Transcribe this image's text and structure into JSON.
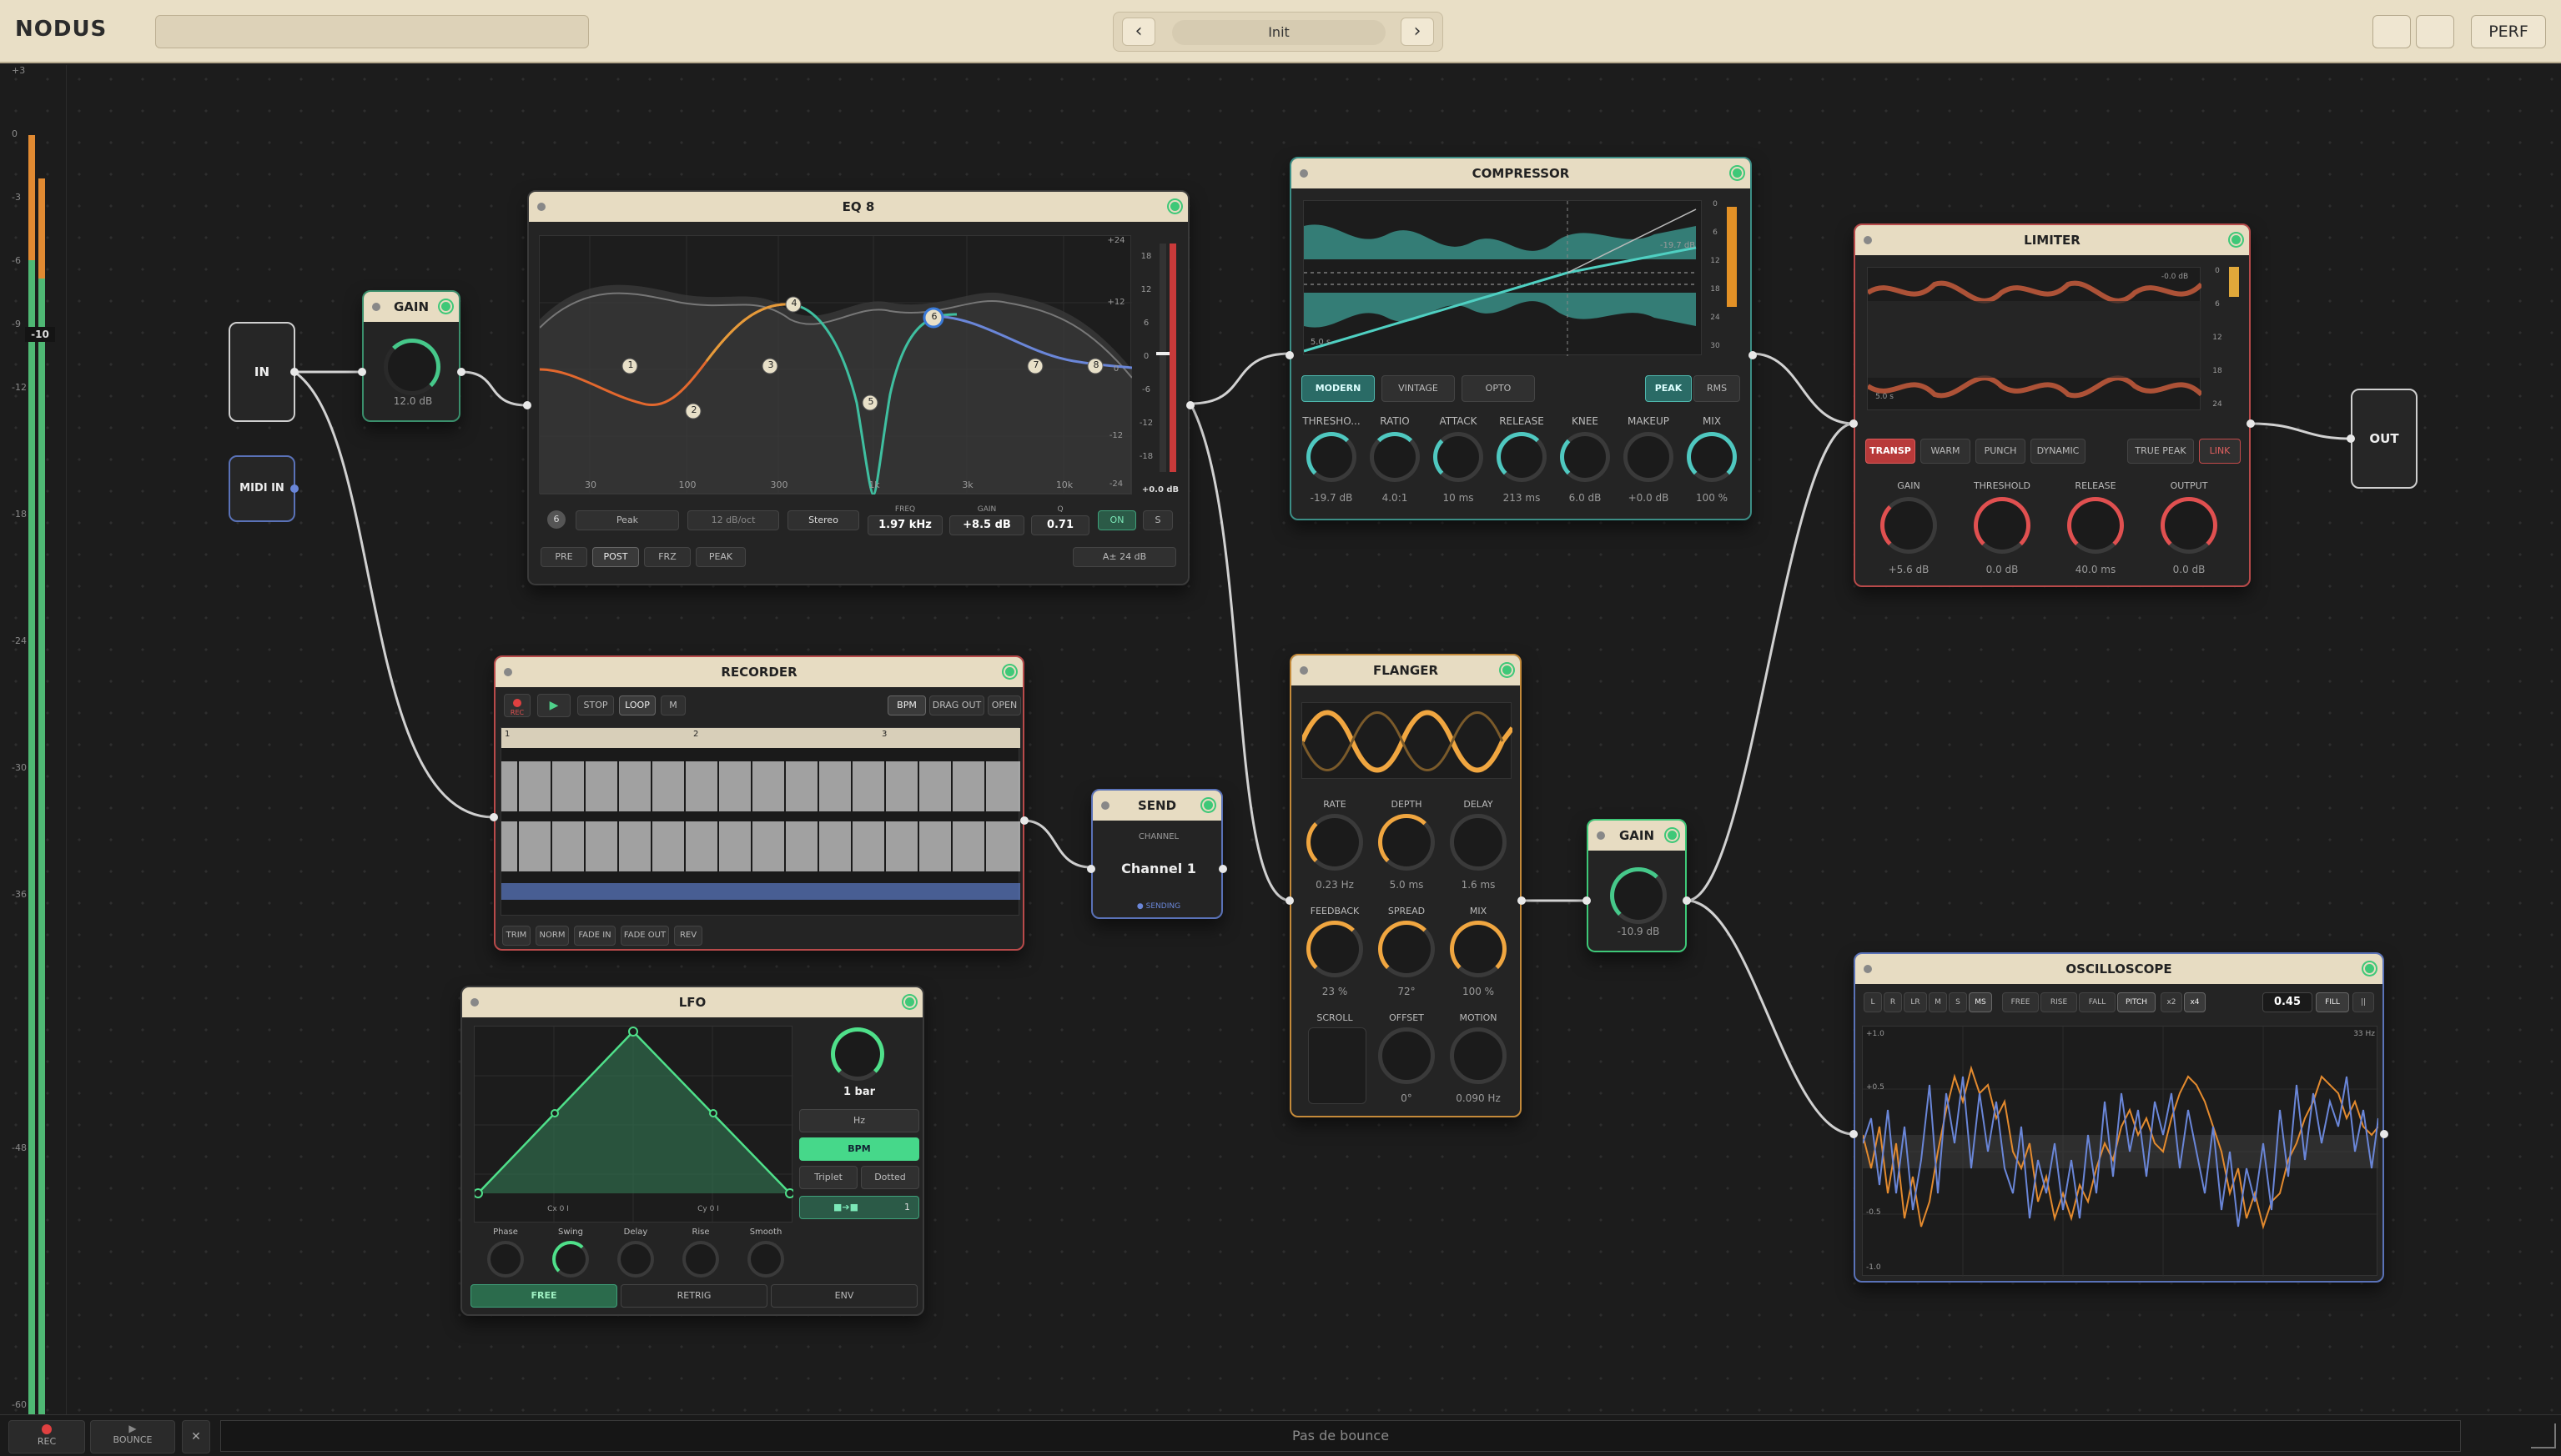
{
  "app": {
    "title": "NODUS",
    "preset": "Init",
    "perf_label": "PERF"
  },
  "meter": {
    "ticks": [
      "+3",
      "0",
      "-3",
      "-6",
      "-9",
      "-12",
      "-18",
      "-24",
      "-30",
      "-36",
      "-48",
      "-60"
    ],
    "readout": "-10"
  },
  "io": {
    "in": "IN",
    "midi_in": "MIDI IN",
    "out": "OUT"
  },
  "gain1": {
    "title": "GAIN",
    "value": "12.0 dB"
  },
  "eq": {
    "title": "EQ 8",
    "freq_labels": [
      "30",
      "100",
      "300",
      "1k",
      "3k",
      "10k"
    ],
    "db_labels": [
      "+24",
      "+12",
      "0",
      "-12",
      "-24"
    ],
    "db_right": [
      "18",
      "12",
      "6",
      "0",
      "-6",
      "-12",
      "-18"
    ],
    "meter_readout": "+0.0 dB",
    "band_num": "6",
    "type": "Peak",
    "slope": "12 dB/oct",
    "mode": "Stereo",
    "freq_label": "FREQ",
    "freq": "1.97 kHz",
    "gain_label": "GAIN",
    "gain": "+8.5 dB",
    "q_label": "Q",
    "q": "0.71",
    "on": "ON",
    "solo": "S",
    "pre": "PRE",
    "post": "POST",
    "frz": "FRZ",
    "peak": "PEAK",
    "range": "A± 24 dB",
    "points": [
      "1",
      "2",
      "3",
      "4",
      "5",
      "6",
      "7",
      "8"
    ]
  },
  "compressor": {
    "title": "COMPRESSOR",
    "modes": [
      "MODERN",
      "VINTAGE",
      "OPTO"
    ],
    "det": [
      "PEAK",
      "RMS"
    ],
    "thresh_tag": "-19.7 dB",
    "ratio_tag": "5.0 s",
    "scale": [
      "0",
      "6",
      "12",
      "18",
      "24",
      "30"
    ],
    "knobs": [
      {
        "label": "THRESHO...",
        "value": "-19.7 dB"
      },
      {
        "label": "RATIO",
        "value": "4.0:1"
      },
      {
        "label": "ATTACK",
        "value": "10 ms"
      },
      {
        "label": "RELEASE",
        "value": "213 ms"
      },
      {
        "label": "KNEE",
        "value": "6.0 dB"
      },
      {
        "label": "MAKEUP",
        "value": "+0.0 dB"
      },
      {
        "label": "MIX",
        "value": "100 %"
      }
    ]
  },
  "limiter": {
    "title": "LIMITER",
    "modes": [
      "TRANSP",
      "WARM",
      "PUNCH",
      "DYNAMIC"
    ],
    "true_peak": "TRUE PEAK",
    "link": "LINK",
    "scope_tag": "-0.0 dB",
    "scope_time": "5.0 s",
    "scale": [
      "0",
      "6",
      "12",
      "18",
      "24"
    ],
    "knobs": [
      {
        "label": "GAIN",
        "value": "+5.6 dB"
      },
      {
        "label": "THRESHOLD",
        "value": "0.0 dB"
      },
      {
        "label": "RELEASE",
        "value": "40.0 ms"
      },
      {
        "label": "OUTPUT",
        "value": "0.0 dB"
      }
    ]
  },
  "recorder": {
    "title": "RECORDER",
    "rec": "REC",
    "stop": "STOP",
    "loop": "LOOP",
    "m": "M",
    "bpm": "BPM",
    "drag_out": "DRAG OUT",
    "open": "OPEN",
    "bars": [
      "1",
      "2",
      "3"
    ],
    "tools": [
      "TRIM",
      "NORM",
      "FADE IN",
      "FADE OUT",
      "REV"
    ]
  },
  "send": {
    "title": "SEND",
    "channel_label": "CHANNEL",
    "channel": "Channel 1",
    "status": "● SENDING"
  },
  "flanger": {
    "title": "FLANGER",
    "knobs": [
      {
        "label": "RATE",
        "value": "0.23 Hz"
      },
      {
        "label": "DEPTH",
        "value": "5.0 ms"
      },
      {
        "label": "DELAY",
        "value": "1.6 ms"
      },
      {
        "label": "FEEDBACK",
        "value": "23 %"
      },
      {
        "label": "SPREAD",
        "value": "72°"
      },
      {
        "label": "MIX",
        "value": "100 %"
      },
      {
        "label": "SCROLL",
        "value": ""
      },
      {
        "label": "OFFSET",
        "value": "0°"
      },
      {
        "label": "MOTION",
        "value": "0.090 Hz"
      }
    ]
  },
  "gain2": {
    "title": "GAIN",
    "value": "-10.9 dB"
  },
  "lfo": {
    "title": "LFO",
    "rate": "1 bar",
    "hz": "Hz",
    "bpm": "BPM",
    "triplet": "Triplet",
    "dotted": "Dotted",
    "sync_value": "1",
    "phase_left": "Cx 0 I",
    "phase_right": "Cy 0 I",
    "knobs": [
      "Phase",
      "Swing",
      "Delay",
      "Rise",
      "Smooth"
    ],
    "modes": [
      "FREE",
      "RETRIG",
      "ENV"
    ]
  },
  "scope": {
    "title": "OSCILLOSCOPE",
    "chan": [
      "L",
      "R",
      "LR",
      "M",
      "S",
      "MS"
    ],
    "trig": [
      "FREE",
      "RISE",
      "FALL",
      "PITCH"
    ],
    "zoom": [
      "x2",
      "x4"
    ],
    "value": "0.45",
    "fill": "FILL",
    "menu": "||",
    "freq": "33 Hz",
    "y": [
      "+1.0",
      "+0.5",
      "-0.5",
      "-1.0"
    ]
  },
  "bottom": {
    "rec": "REC",
    "bounce": "BOUNCE",
    "close": "✕",
    "status": "Pas de bounce"
  },
  "colors": {
    "accent_teal": "#3fb8a6",
    "accent_orange": "#f0a640",
    "accent_red": "#e25050",
    "accent_green": "#3ec878",
    "accent_blue": "#6a86d8"
  }
}
